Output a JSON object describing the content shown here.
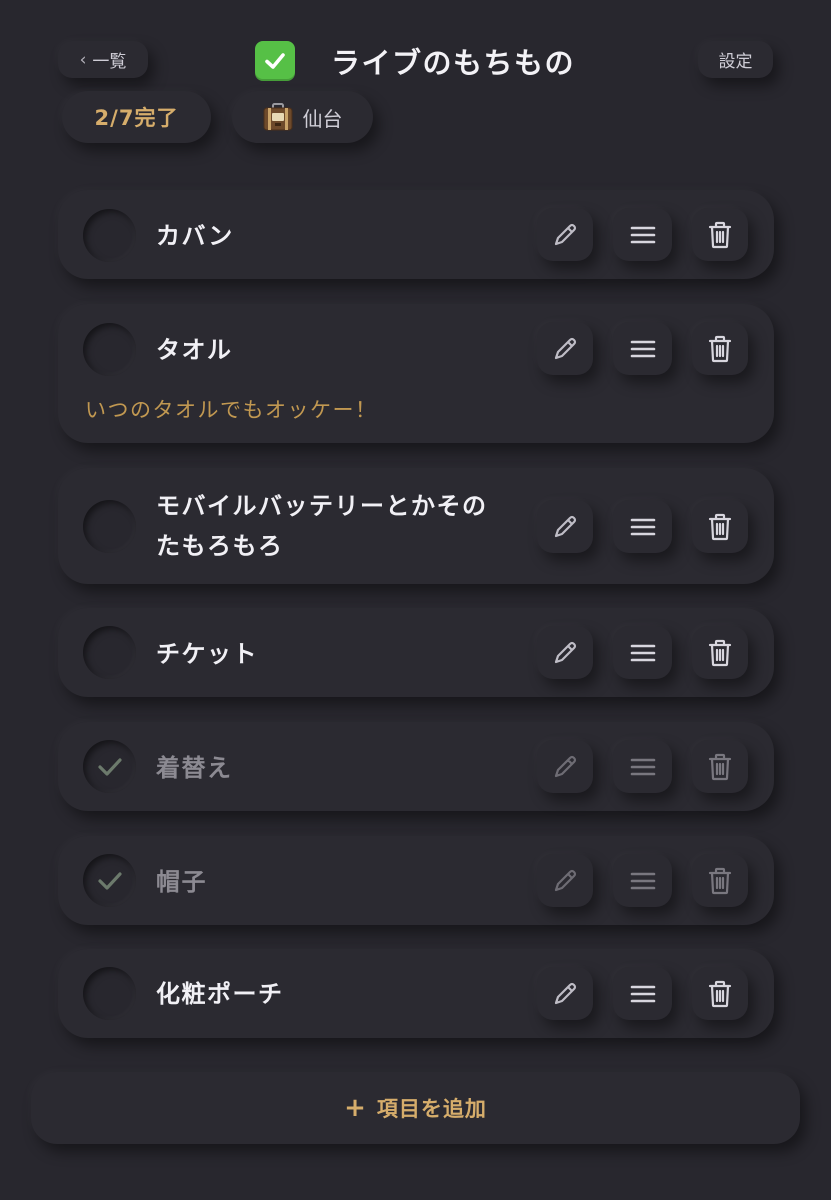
{
  "header": {
    "back_label": "一覧",
    "back_chevron": "‹",
    "title": "ライブのもちもの",
    "title_icon": "check-mark-button-emoji",
    "settings_label": "設定",
    "progress_label": "2/7完了",
    "place_icon": "luggage-icon",
    "place_label": "仙台"
  },
  "colors": {
    "background": "#28272e",
    "accent": "#d6ad6b",
    "note": "#c19851",
    "done_text": "#8c8a92"
  },
  "items": [
    {
      "name": "カバン",
      "note": "",
      "checked": false
    },
    {
      "name": "タオル",
      "note": "いつのタオルでもオッケー！",
      "checked": false
    },
    {
      "name": "モバイルバッテリーとかそのたもろもろ",
      "note": "",
      "checked": false
    },
    {
      "name": "チケット",
      "note": "",
      "checked": false
    },
    {
      "name": "着替え",
      "note": "",
      "checked": true
    },
    {
      "name": "帽子",
      "note": "",
      "checked": true
    },
    {
      "name": "化粧ポーチ",
      "note": "",
      "checked": false
    }
  ],
  "add_button": {
    "icon": "+",
    "label": "項目を追加"
  }
}
